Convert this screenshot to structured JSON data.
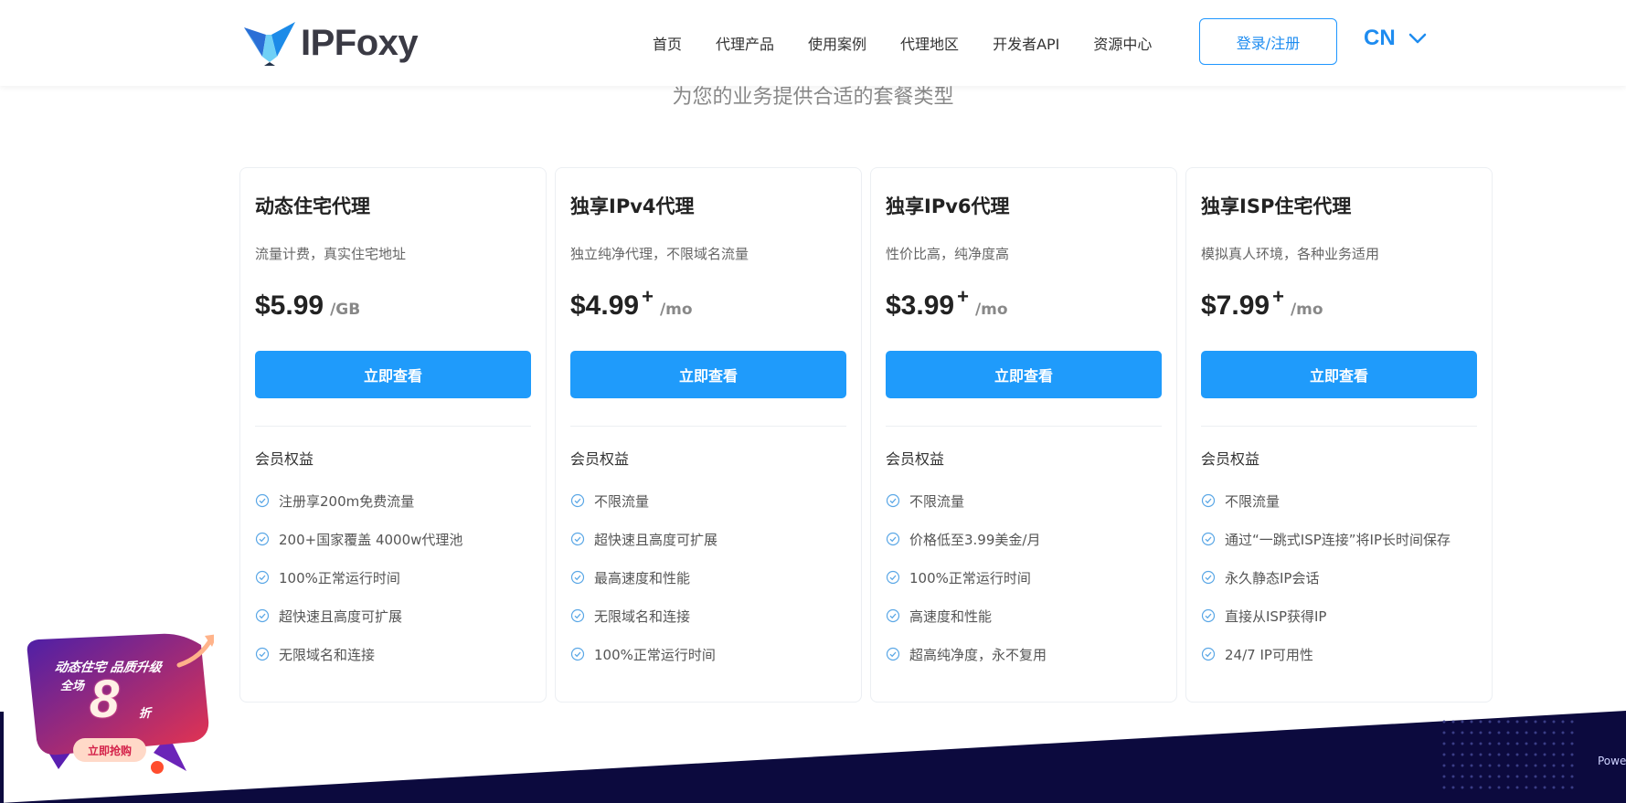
{
  "brand": {
    "name": "IPFoxy"
  },
  "nav": {
    "items": [
      "首页",
      "代理产品",
      "使用案例",
      "代理地区",
      "开发者API",
      "资源中心"
    ],
    "login_label": "登录/注册",
    "lang": "CN"
  },
  "subtitle": "为您的业务提供合适的套餐类型",
  "cards": [
    {
      "title": "动态住宅代理",
      "desc": "流量计费，真实住宅地址",
      "price": "$5.99",
      "plus": "",
      "unit": "/GB",
      "cta": "立即查看",
      "benefits_title": "会员权益",
      "features": [
        "注册享200m免费流量",
        "200+国家覆盖 4000w代理池",
        "100%正常运行时间",
        "超快速且高度可扩展",
        "无限域名和连接"
      ]
    },
    {
      "title": "独享IPv4代理",
      "desc": "独立纯净代理，不限域名流量",
      "price": "$4.99",
      "plus": "+",
      "unit": "/mo",
      "cta": "立即查看",
      "benefits_title": "会员权益",
      "features": [
        "不限流量",
        "超快速且高度可扩展",
        "最高速度和性能",
        "无限域名和连接",
        "100%正常运行时间"
      ]
    },
    {
      "title": "独享IPv6代理",
      "desc": "性价比高，纯净度高",
      "price": "$3.99",
      "plus": "+",
      "unit": "/mo",
      "cta": "立即查看",
      "benefits_title": "会员权益",
      "features": [
        "不限流量",
        "价格低至3.99美金/月",
        "100%正常运行时间",
        "高速度和性能",
        "超高纯净度，永不复用"
      ]
    },
    {
      "title": "独享ISP住宅代理",
      "desc": "模拟真人环境，各种业务适用",
      "price": "$7.99",
      "plus": "+",
      "unit": "/mo",
      "cta": "立即查看",
      "benefits_title": "会员权益",
      "features": [
        "不限流量",
        "通过“一跳式ISP连接”将IP长时间保存",
        "永久静态IP会话",
        "直接从ISP获得IP",
        "24/7 IP可用性"
      ]
    }
  ],
  "promo": {
    "line1": "动态住宅  品质升级",
    "line2": "全场",
    "number": "8",
    "suffix": "折",
    "button": "立即抢购"
  },
  "footer": {
    "powered_text": "Powe"
  },
  "colors": {
    "accent": "#1f9bfb",
    "dark_band": "#0c0a3e"
  }
}
